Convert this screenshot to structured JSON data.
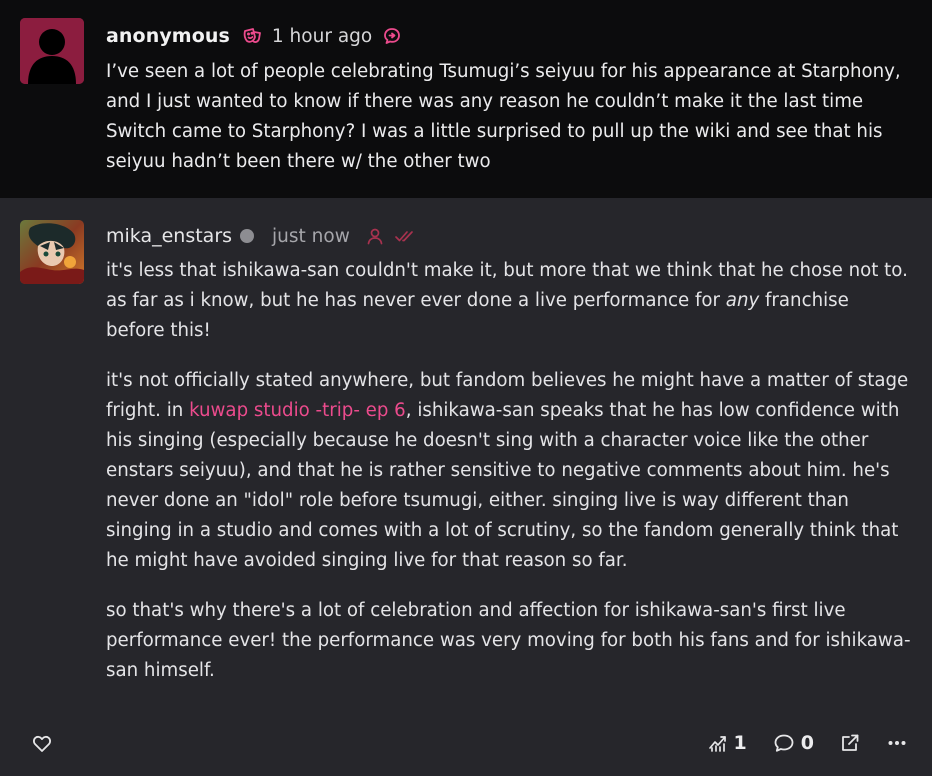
{
  "ask": {
    "author": "anonymous",
    "time": "1 hour ago",
    "text": "I’ve seen a lot of people celebrating Tsumugi’s seiyuu for his appearance at Starphony, and I just wanted to know if there was any reason he couldn’t make it the last time Switch came to Starphony? I was a little surprised to pull up the wiki and see that his seiyuu hadn’t been there w/ the other two"
  },
  "answer": {
    "author": "mika_enstars",
    "time": "just now",
    "p1_before": "it's less that ishikawa-san couldn't make it, but more that we think that he chose not to. as far as i know, but he has never ever done a live performance for ",
    "p1_em": "any",
    "p1_after": " franchise before this!",
    "p2_before": "it's not officially stated anywhere, but fandom believes he might have a matter of stage fright. in ",
    "p2_link": "kuwap studio -trip- ep 6",
    "p2_after": ", ishikawa-san speaks that he has low confidence with his singing (especially because he doesn't sing with a character voice like the other enstars seiyuu), and that he is rather sensitive to negative comments about him. he's never done an \"idol\" role before tsumugi, either. singing live is way different than singing in a studio and comes with a lot of scrutiny, so the fandom generally think that he might have avoided singing live for that reason so far.",
    "p3": "so that's why there's a lot of celebration and affection for ishikawa-san's first live performance ever! the performance was very moving for both his fans and for ishikawa-san himself."
  },
  "footer": {
    "stats_count": "1",
    "comments_count": "0"
  },
  "colors": {
    "accent": "#ec4b8d",
    "ask_bg": "#0c0c0d",
    "answer_bg": "#26262b",
    "anon_avatar": "#8c1d3f"
  },
  "icons": {
    "ask_badge": "anonymous-mask-icon",
    "ask_reply": "reply-bubble-icon",
    "answer_user": "person-icon",
    "answer_read": "double-check-icon",
    "like": "heart-icon",
    "stats": "stats-chart-icon",
    "comments": "comment-bubble-icon",
    "share": "share-external-icon",
    "more": "more-dots-icon"
  }
}
